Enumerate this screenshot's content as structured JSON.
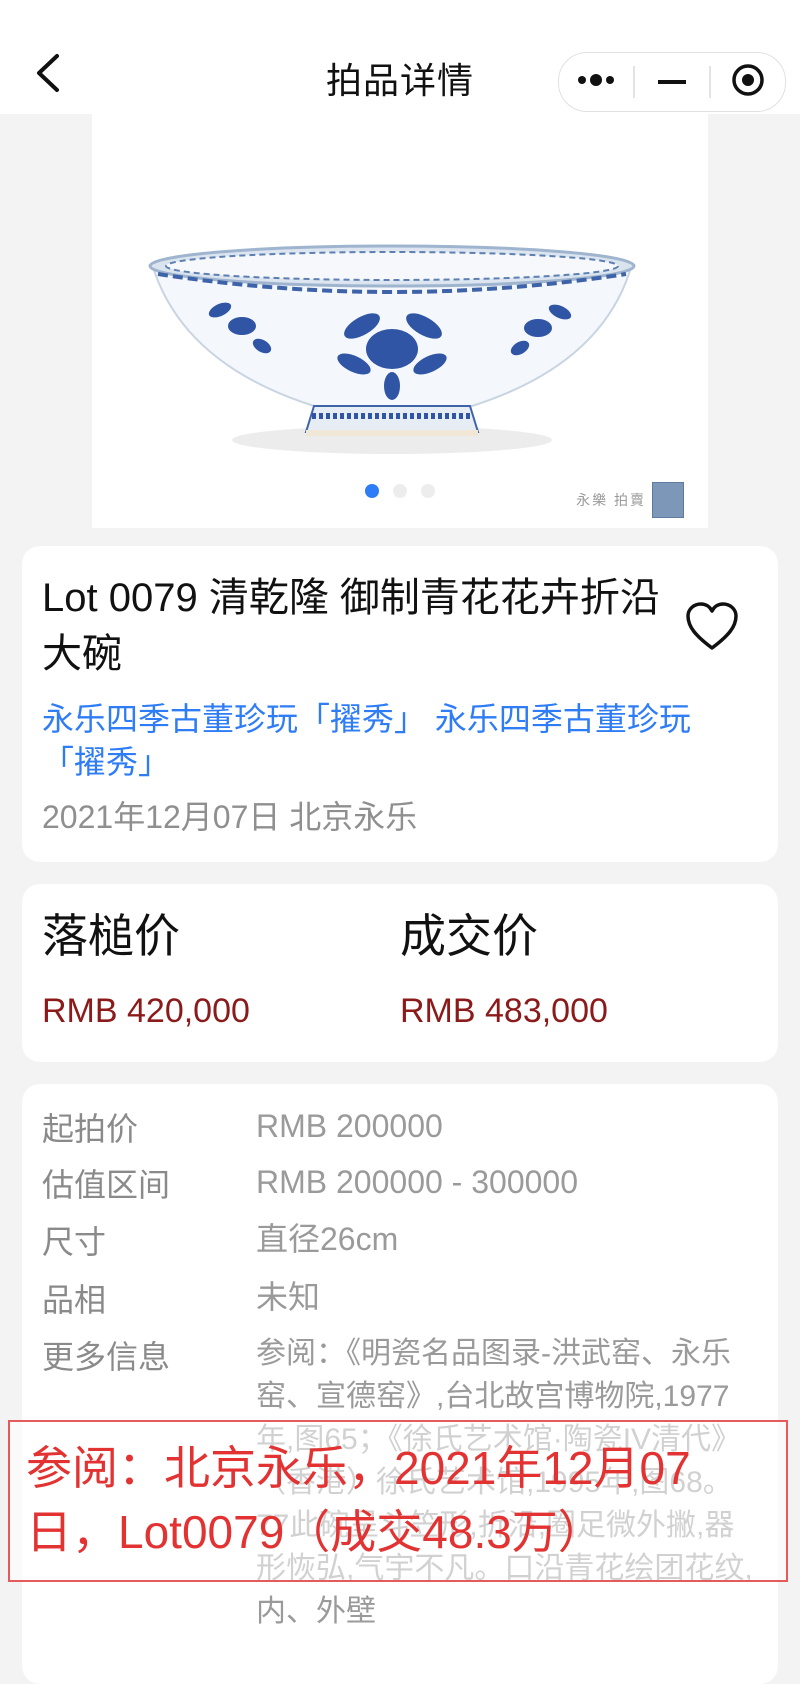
{
  "header": {
    "title": "拍品详情",
    "back_icon": "chevron-left-icon",
    "capsule_icons": [
      "more-dots-icon",
      "minimize-icon",
      "target-icon"
    ]
  },
  "gallery": {
    "image_alt": "青花花卉折沿大碗",
    "watermark_text": "永樂 拍賣",
    "dot_count": 3,
    "active_dot": 0
  },
  "lot": {
    "title": "Lot 0079 清乾隆 御制青花花卉折沿大碗",
    "sale_name": "永乐四季古董珍玩「擢秀」 永乐四季古董珍玩「擢秀」",
    "date_location": "2021年12月07日 北京永乐",
    "favorite_icon": "heart-outline-icon"
  },
  "prices": {
    "hammer_label": "落槌价",
    "hammer_value": "RMB 420,000",
    "final_label": "成交价",
    "final_value": "RMB 483,000"
  },
  "info": {
    "rows": [
      {
        "label": "起拍价",
        "value": "RMB 200000"
      },
      {
        "label": "估值区间",
        "value": "RMB 200000 - 300000"
      },
      {
        "label": "尺寸",
        "value": "直径26cm"
      },
      {
        "label": "品相",
        "value": "未知"
      }
    ],
    "more_label": "更多信息",
    "more_value": "参阅：《明瓷名品图录-洪武窑、永乐窑、宣德窑》,台北故宫博物院,1977年,图65；《徐氏艺术馆·陶瓷IV清代》（香港）徐氏艺术馆,1995年,图68。77此碗呈斗笠形,折沿,圈足微外撇,器形恢弘,气宇不凡。口沿青花绘团花纹,内、外壁"
  },
  "overlay": {
    "text": "参阅：北京永乐，2021年12月07日，Lot0079（成交48.3万）"
  },
  "colors": {
    "accent_blue": "#2e7cf6",
    "price_red": "#8b1a1a",
    "overlay_red": "#e33232"
  }
}
